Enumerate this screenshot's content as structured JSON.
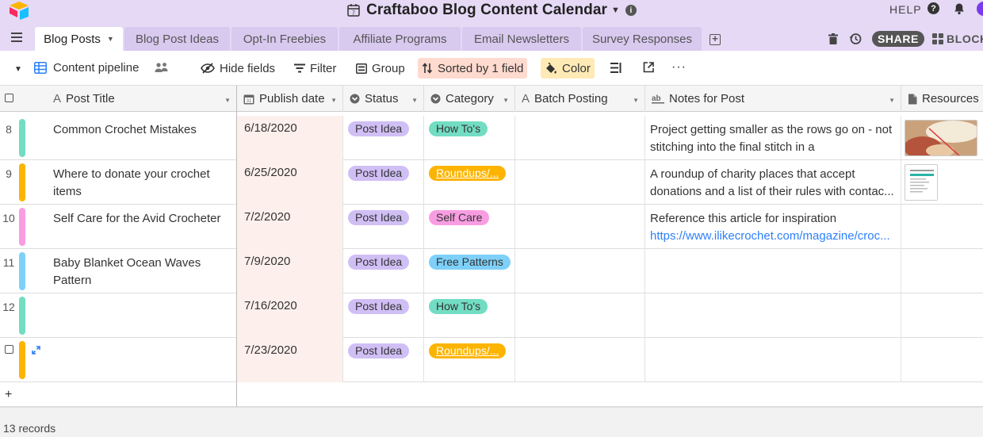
{
  "app": {
    "base_title": "Craftaboo Blog Content Calendar",
    "help_label": "HELP",
    "share_label": "SHARE",
    "blocks_label": "BLOCKS"
  },
  "tabs": [
    {
      "label": "Blog Posts",
      "active": true
    },
    {
      "label": "Blog Post Ideas",
      "active": false
    },
    {
      "label": "Opt-In Freebies",
      "active": false
    },
    {
      "label": "Affiliate Programs",
      "active": false
    },
    {
      "label": "Email Newsletters",
      "active": false
    },
    {
      "label": "Survey Responses",
      "active": false
    }
  ],
  "viewbar": {
    "view_name": "Content pipeline",
    "hide_fields": "Hide fields",
    "filter": "Filter",
    "group": "Group",
    "sort": "Sorted by 1 field",
    "color": "Color"
  },
  "columns": {
    "post_title": "Post Title",
    "publish_date": "Publish date",
    "status": "Status",
    "category": "Category",
    "batch_posting": "Batch Posting",
    "notes": "Notes for Post",
    "resources": "Resources"
  },
  "colors": {
    "accent_purple": "#e5d9f5",
    "status_post_idea": "#d0bff5",
    "cat_how_tos": "#72ddc3",
    "cat_roundups": "#fcb400",
    "cat_self_care": "#f99de2",
    "cat_free_patterns": "#7ed0f9",
    "link": "#2d7ff9",
    "sort_bg": "#ffdacf",
    "color_bg": "#ffeab6"
  },
  "rows": [
    {
      "num": "8",
      "title": "Common Crochet Mistakes",
      "date": "6/18/2020",
      "status": "Post Idea",
      "category": "How To's",
      "cat_color": "#72ddc3",
      "bar_color": "#72ddc3",
      "notes_line1": "Project getting smaller as the rows go on - not",
      "notes_line2": "stitching into the final stitch in a",
      "has_photo": true
    },
    {
      "num": "9",
      "title": "Where to donate your crochet items",
      "date": "6/25/2020",
      "status": "Post Idea",
      "category": "Roundups/...",
      "cat_color": "#fcb400",
      "bar_color": "#fcb400",
      "notes_line1": "A roundup of charity places that accept",
      "notes_line2": "donations and a list of their rules with contac...",
      "has_doc": true
    },
    {
      "num": "10",
      "title": "Self Care for the Avid Crocheter",
      "date": "7/2/2020",
      "status": "Post Idea",
      "category": "Self Care",
      "cat_color": "#f99de2",
      "bar_color": "#f99de2",
      "notes_line1": "Reference this article for inspiration",
      "notes_link": "https://www.ilikecrochet.com/magazine/croc..."
    },
    {
      "num": "11",
      "title": "Baby Blanket Ocean Waves Pattern",
      "date": "7/9/2020",
      "status": "Post Idea",
      "category": "Free Patterns",
      "cat_color": "#7ed0f9",
      "bar_color": "#7ed0f9"
    },
    {
      "num": "12",
      "title": "",
      "date": "7/16/2020",
      "status": "Post Idea",
      "category": "How To's",
      "cat_color": "#72ddc3",
      "bar_color": "#72ddc3"
    },
    {
      "num": "",
      "title": "",
      "date": "7/23/2020",
      "status": "Post Idea",
      "category": "Roundups/...",
      "cat_color": "#fcb400",
      "bar_color": "#fcb400",
      "hovered": true
    }
  ],
  "footer": {
    "records": "13 records"
  }
}
